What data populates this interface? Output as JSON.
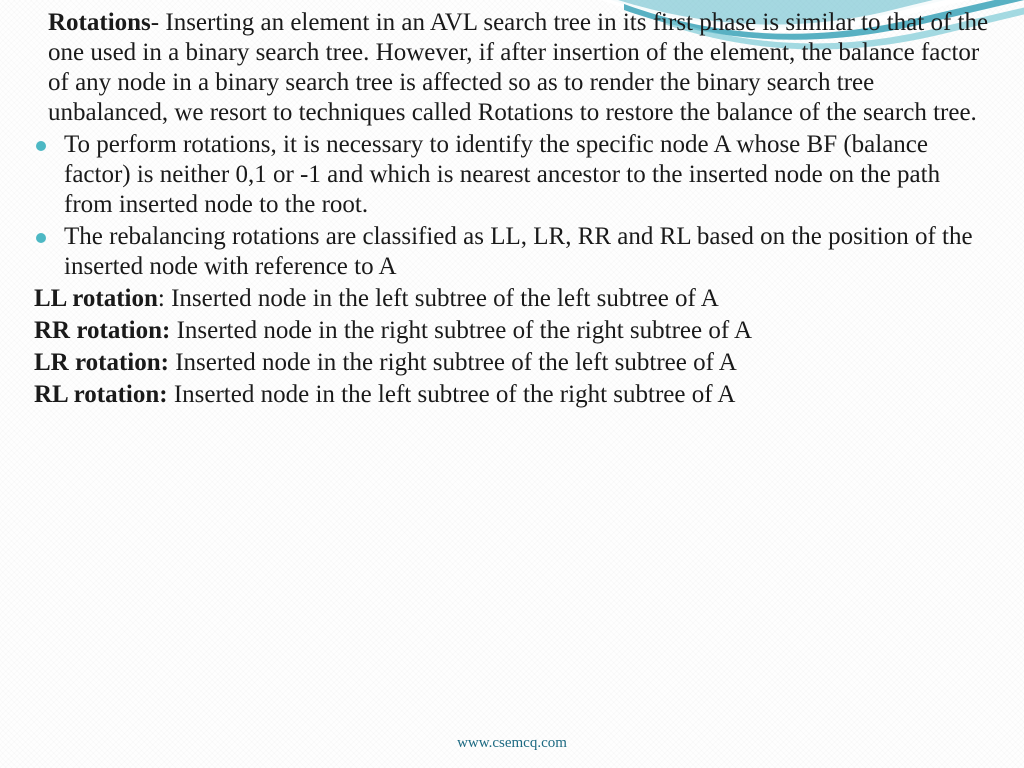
{
  "intro": {
    "heading": "Rotations",
    "text": "- Inserting an element in an AVL search tree in its first phase is similar to that of the one used in a binary search tree. However, if after insertion of the element, the balance factor of any node in a binary search tree is affected so as to render the binary search tree unbalanced, we resort to techniques called Rotations to restore the balance of the search tree."
  },
  "bullets": [
    "To perform rotations, it is necessary to identify the specific node A whose BF (balance factor) is neither 0,1 or -1 and which is nearest ancestor  to the inserted node on the path from inserted node to the root.",
    "The rebalancing rotations are classified as LL, LR, RR and RL based on the position of the inserted node with reference to A"
  ],
  "rotations": [
    {
      "label": "LL rotation",
      "sep": ": ",
      "desc": "Inserted node in the left subtree of the left subtree of A"
    },
    {
      "label": "RR rotation:",
      "sep": " ",
      "desc": "Inserted node in the right subtree of the right subtree of  A"
    },
    {
      "label": "LR rotation:",
      "sep": " ",
      "desc": "Inserted node in the right subtree of the left subtree of A"
    },
    {
      "label": "RL rotation:",
      "sep": " ",
      "desc": "Inserted node in the left subtree of the right subtree of A"
    }
  ],
  "footer": "www.csemcq.com"
}
